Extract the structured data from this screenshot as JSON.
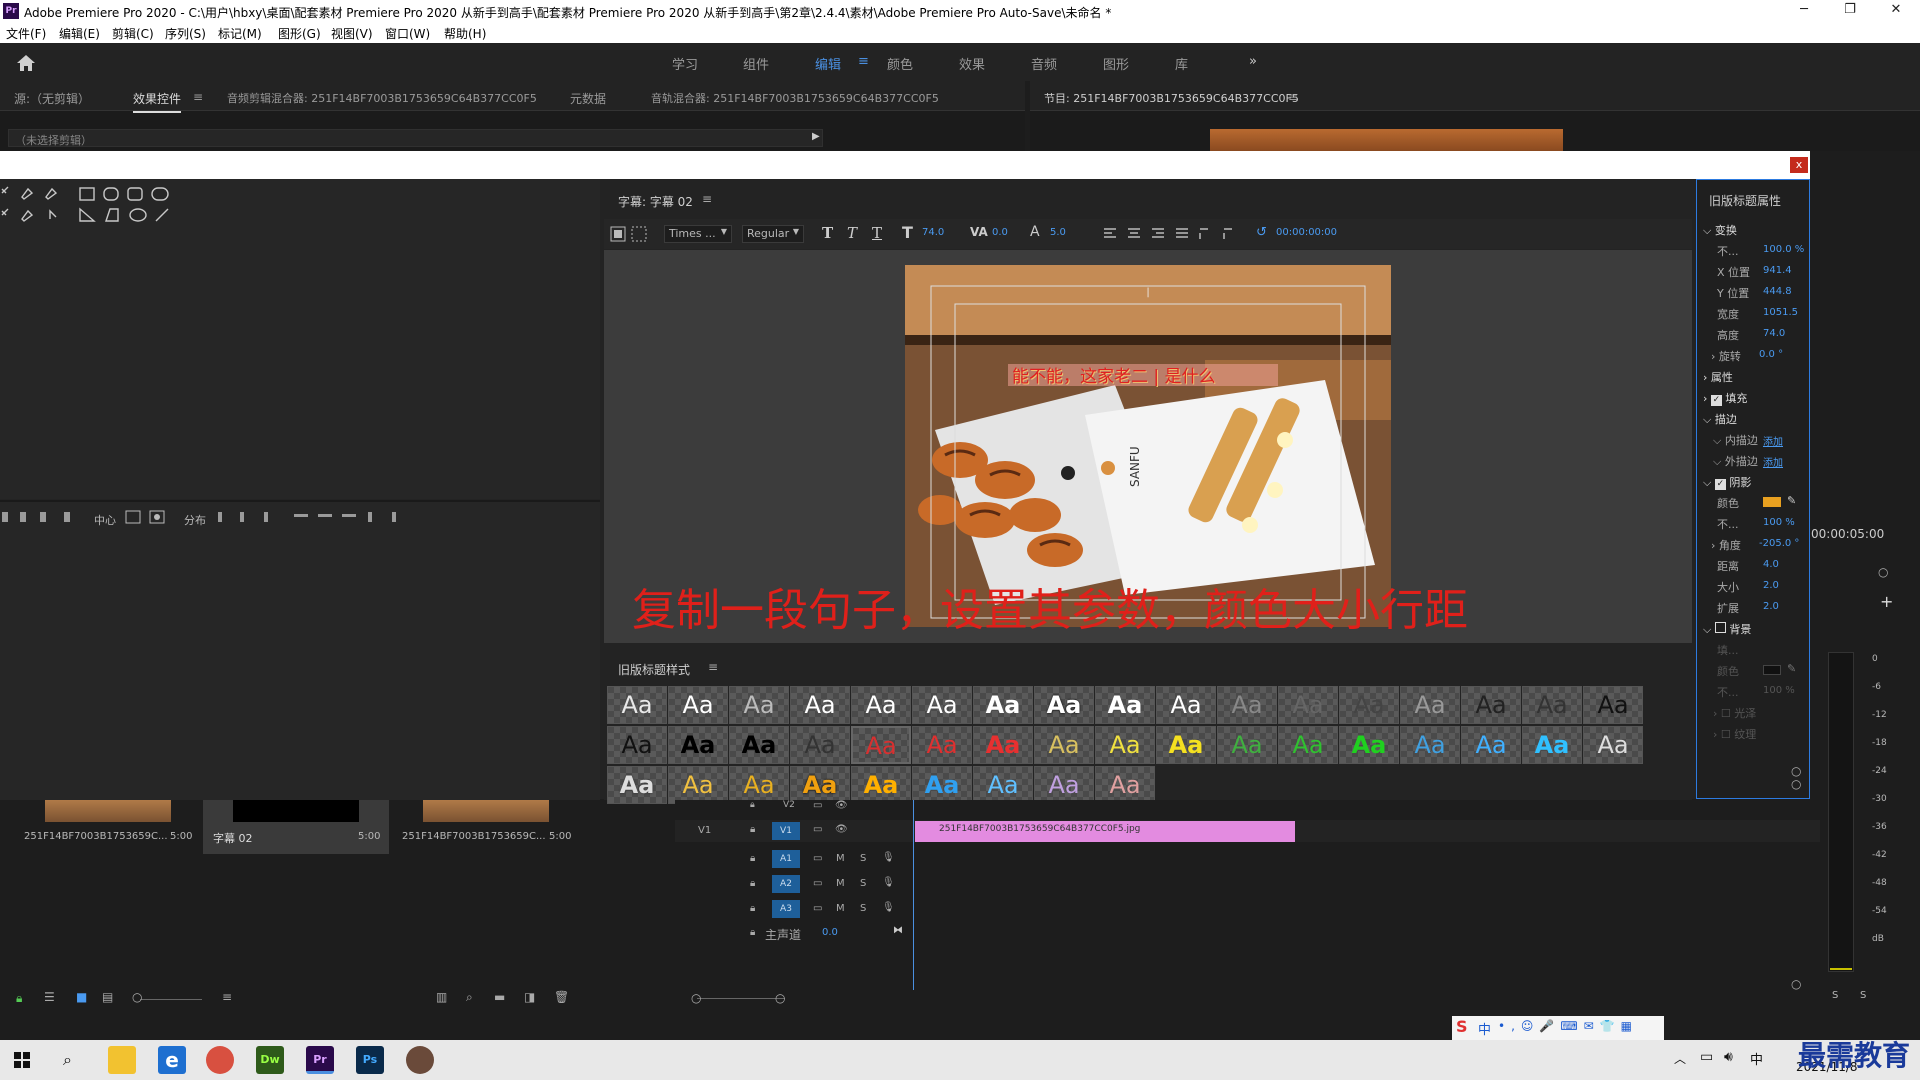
{
  "window": {
    "title": "Adobe Premiere Pro 2020 - C:\\用户\\hbxy\\桌面\\配套素材 Premiere Pro 2020 从新手到高手\\配套素材 Premiere Pro 2020 从新手到高手\\第2章\\2.4.4\\素材\\Adobe Premiere Pro Auto-Save\\未命名 *",
    "logo": "Pr"
  },
  "menu": [
    "文件(F)",
    "编辑(E)",
    "剪辑(C)",
    "序列(S)",
    "标记(M)",
    "图形(G)",
    "视图(V)",
    "窗口(W)",
    "帮助(H)"
  ],
  "workspaces": [
    "学习",
    "组件",
    "编辑",
    "颜色",
    "效果",
    "音频",
    "图形",
    "库"
  ],
  "workspace_active": "编辑",
  "workspace_more": "»",
  "source_tabs": [
    "源:（无剪辑）",
    "效果控件",
    "音频剪辑混合器: 251F14BF7003B1753659C64B377CC0F5",
    "元数据",
    "音轨混合器: 251F14BF7003B1753659C64B377CC0F5"
  ],
  "source_subtitle": "（未选择剪辑）",
  "program_tab": "节目: 251F14BF7003B1753659C64B377CC0F5",
  "dialog_close": "x",
  "editor": {
    "tab": "字幕: 字幕 02",
    "font": "Times ...",
    "style": "Regular",
    "size_label": "74.0",
    "kerning": "0.0",
    "leading": "5.0",
    "timecode": "00:00:00:00",
    "title_text": "能不能，这家老二 | 是什么",
    "overlay_text": "复制一段句子，设置其参数，颜色大小行距",
    "logo_on_plate": "SANFU"
  },
  "align_labels": {
    "center": "中心",
    "distribute": "分布"
  },
  "styles_panel": {
    "title": "旧版标题样式",
    "swatch_text": "Aa"
  },
  "props": {
    "title": "旧版标题属性",
    "transform": "变换",
    "opacity_label": "不...",
    "opacity": "100.0 %",
    "x_label": "X 位置",
    "x": "941.4",
    "y_label": "Y 位置",
    "y": "444.8",
    "width_label": "宽度",
    "width": "1051.5",
    "height_label": "高度",
    "height": "74.0",
    "rotation_label": "旋转",
    "rotation": "0.0 °",
    "attributes": "属性",
    "fill": "填充",
    "stroke": "描边",
    "inner_stroke": "内描边",
    "outer_stroke": "外描边",
    "add": "添加",
    "shadow": "阴影",
    "color_label": "颜色",
    "shadow_opacity": "100 %",
    "angle_label": "角度",
    "angle": "-205.0 °",
    "distance_label": "距离",
    "distance": "4.0",
    "size_label": "大小",
    "size": "2.0",
    "spread_label": "扩展",
    "spread": "2.0",
    "background": "背景",
    "bg_fill": "填...",
    "bg_color": "颜色",
    "bg_opacity_label": "不...",
    "bg_opacity": "100 %",
    "sheen": "光泽",
    "texture": "纹理"
  },
  "project": {
    "items": [
      {
        "name": "251F14BF7003B1753659C...",
        "duration": "5:00"
      },
      {
        "name": "字幕 02",
        "duration": "5:00"
      },
      {
        "name": "251F14BF7003B1753659C...",
        "duration": "5:00"
      }
    ]
  },
  "timeline": {
    "time": "00:00:05:00",
    "tracks": [
      "V2",
      "V1",
      "A1",
      "A2",
      "A3"
    ],
    "v1_label": "V1",
    "master": "主声道",
    "master_val": "0.0",
    "clip": "251F14BF7003B1753659C64B377CC0F5.jpg",
    "track_m": "M",
    "track_s": "S"
  },
  "meter_labels": [
    "0",
    "-6",
    "-12",
    "-18",
    "-24",
    "-30",
    "-36",
    "-42",
    "-48",
    "-54",
    "dB"
  ],
  "meter_solo": [
    "S",
    "S"
  ],
  "taskbar": {
    "date": "2021/11/8",
    "ime": "中",
    "watermark": "最需教育"
  },
  "colors": {
    "accent": "#2d7be0",
    "overlay_red": "#e0201a",
    "clip_pink": "#e38be0",
    "shadow_orange": "#e8a020"
  }
}
